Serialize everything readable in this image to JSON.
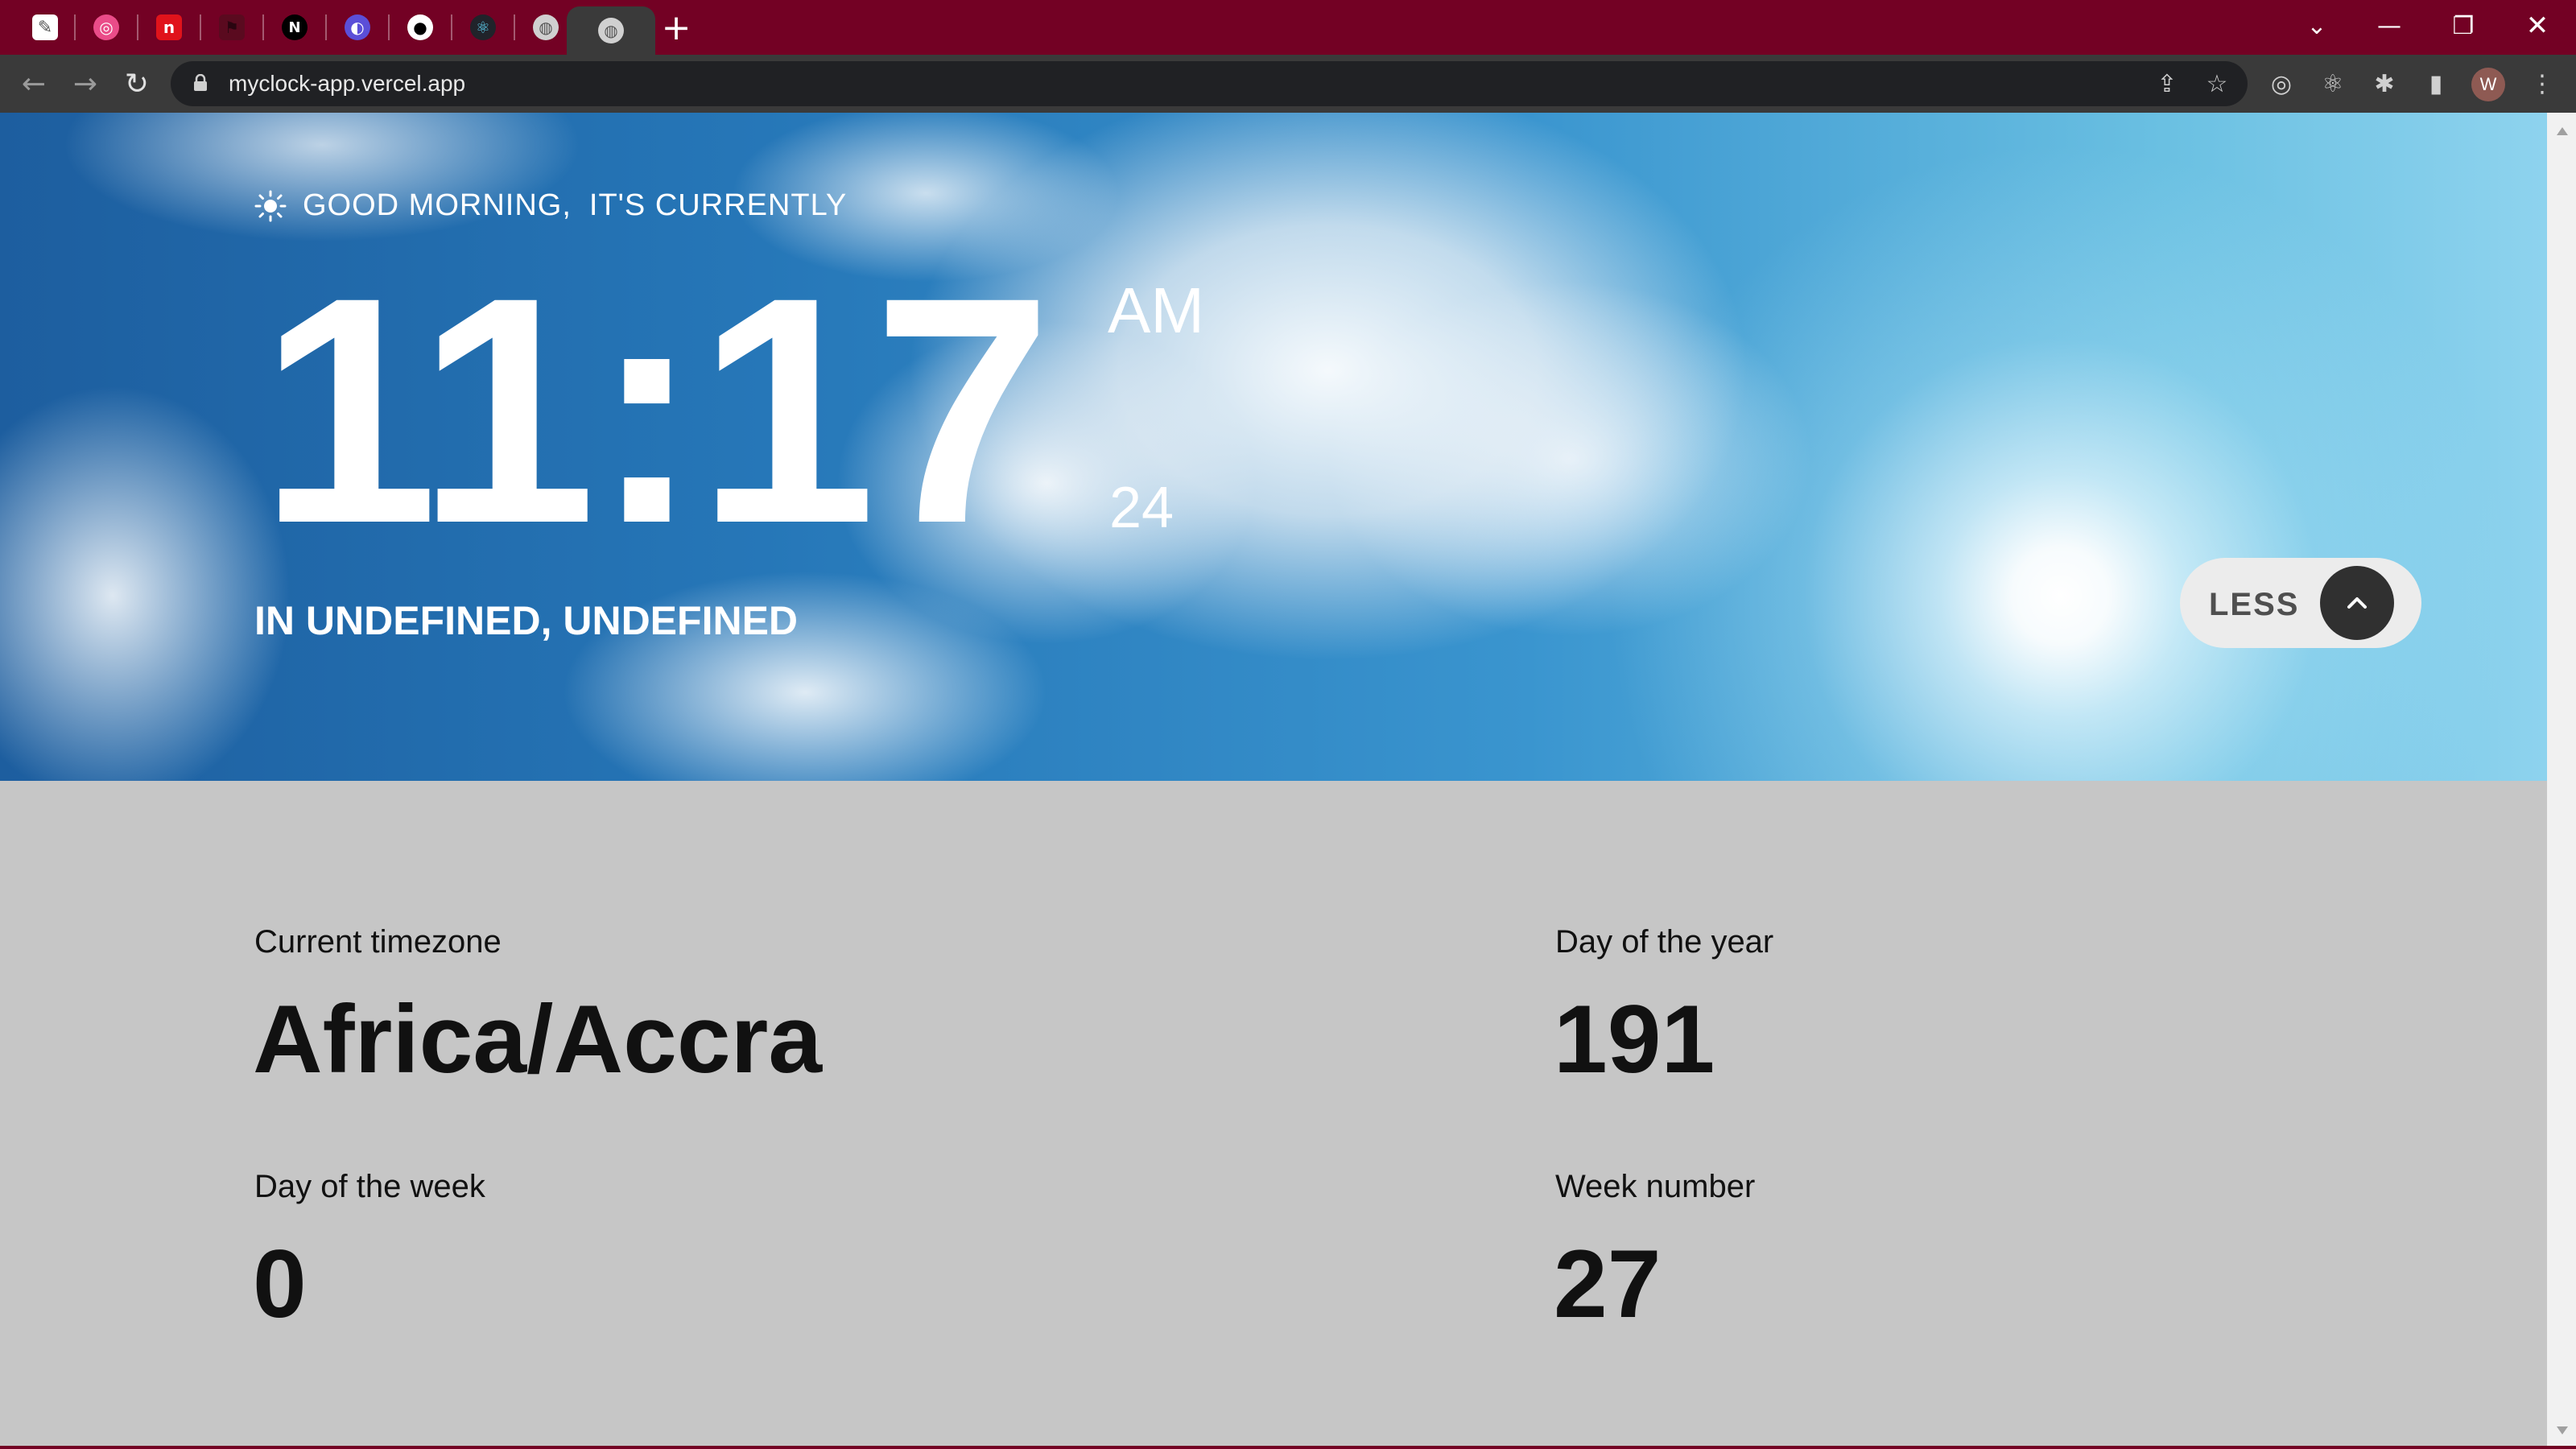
{
  "browser": {
    "tabs": [
      {
        "icon": "note-icon",
        "color": "#ffffff"
      },
      {
        "icon": "dribbble-icon",
        "color": "#ea4c89"
      },
      {
        "icon": "app-red-icon",
        "color": "#e0131b"
      },
      {
        "icon": "flag-icon",
        "color": "#5a0a1f"
      },
      {
        "icon": "next-js-icon",
        "color": "#000000"
      },
      {
        "icon": "ring-icon",
        "color": "#5b4fd8"
      },
      {
        "icon": "github-icon",
        "color": "#ffffff"
      },
      {
        "icon": "react-icon",
        "color": "#61dafb"
      },
      {
        "icon": "globe-icon",
        "color": "#d0d0d0"
      },
      {
        "icon": "globe-icon",
        "color": "#d0d0d0",
        "active": true
      }
    ],
    "url": "myclock-app.vercel.app",
    "profile_initial": "W"
  },
  "hero": {
    "greeting": "GOOD MORNING,",
    "currently": "IT'S CURRENTLY",
    "time": "11:17",
    "meridiem": "AM",
    "seconds": "24",
    "location": "IN UNDEFINED, UNDEFINED",
    "less_label": "LESS"
  },
  "details": {
    "timezone_label": "Current timezone",
    "timezone_value": "Africa/Accra",
    "day_of_year_label": "Day of the year",
    "day_of_year_value": "191",
    "day_of_week_label": "Day of the week",
    "day_of_week_value": "0",
    "week_number_label": "Week number",
    "week_number_value": "27"
  },
  "colors": {
    "tab_bar": "#730124",
    "toolbar": "#3a3a3a",
    "details_bg": "#c6c6c6",
    "less_button_bg": "#ececec",
    "less_circle_bg": "#303030"
  }
}
